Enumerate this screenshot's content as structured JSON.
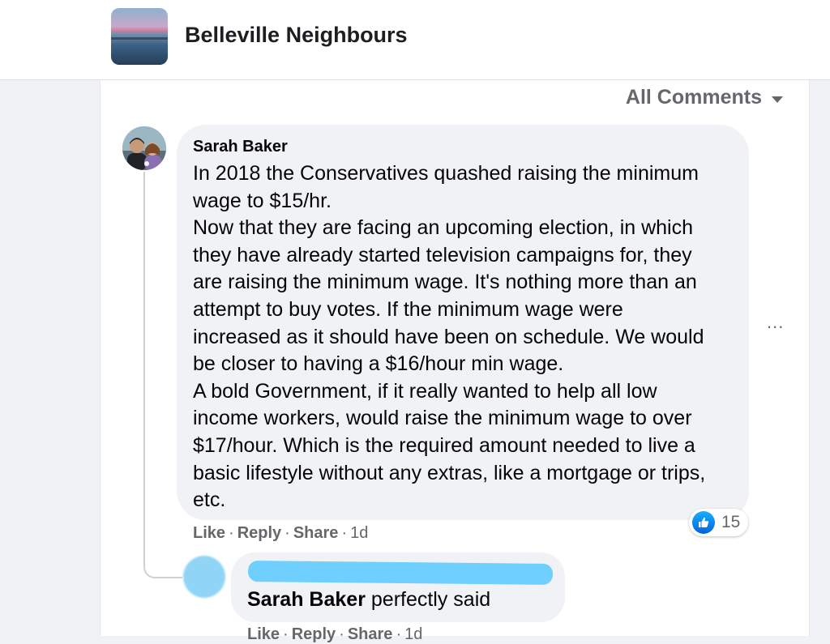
{
  "header": {
    "group_name": "Belleville Neighbours",
    "group_thumbnail_icon": "lake-sunset-thumbnail"
  },
  "comments_filter": {
    "label": "All Comments",
    "icon": "caret-down-icon"
  },
  "comment": {
    "author": "Sarah Baker",
    "lines": [
      "In 2018 the Conservatives quashed raising the minimum",
      "wage to $15/hr.",
      "Now that they are facing an upcoming election, in which",
      "they have already started television campaigns for, they",
      "are raising the minimum wage. It's nothing more than an",
      "attempt to buy votes. If the minimum wage were",
      "increased as it should have been on schedule. We would",
      "be closer to having a $16/hour min wage.",
      "A bold Government, if it really wanted to help all low",
      "income workers, would raise the minimum wage to over",
      "$17/hour. Which is the required amount needed to live a",
      "basic lifestyle without any extras, like a mortgage or trips,",
      "etc."
    ],
    "more_options": "...",
    "reaction_count": "15",
    "reaction_icon": "like-icon",
    "actions": {
      "like": "Like",
      "reply": "Reply",
      "share": "Share",
      "separator": "·",
      "time": "1d"
    }
  },
  "reply": {
    "mention": "Sarah Baker",
    "text": " perfectly said",
    "actions": {
      "like": "Like",
      "reply": "Reply",
      "share": "Share",
      "separator": "·",
      "time": "1d"
    }
  },
  "colors": {
    "like_blue": "#1877f2",
    "redaction": "#6fd0ff"
  }
}
